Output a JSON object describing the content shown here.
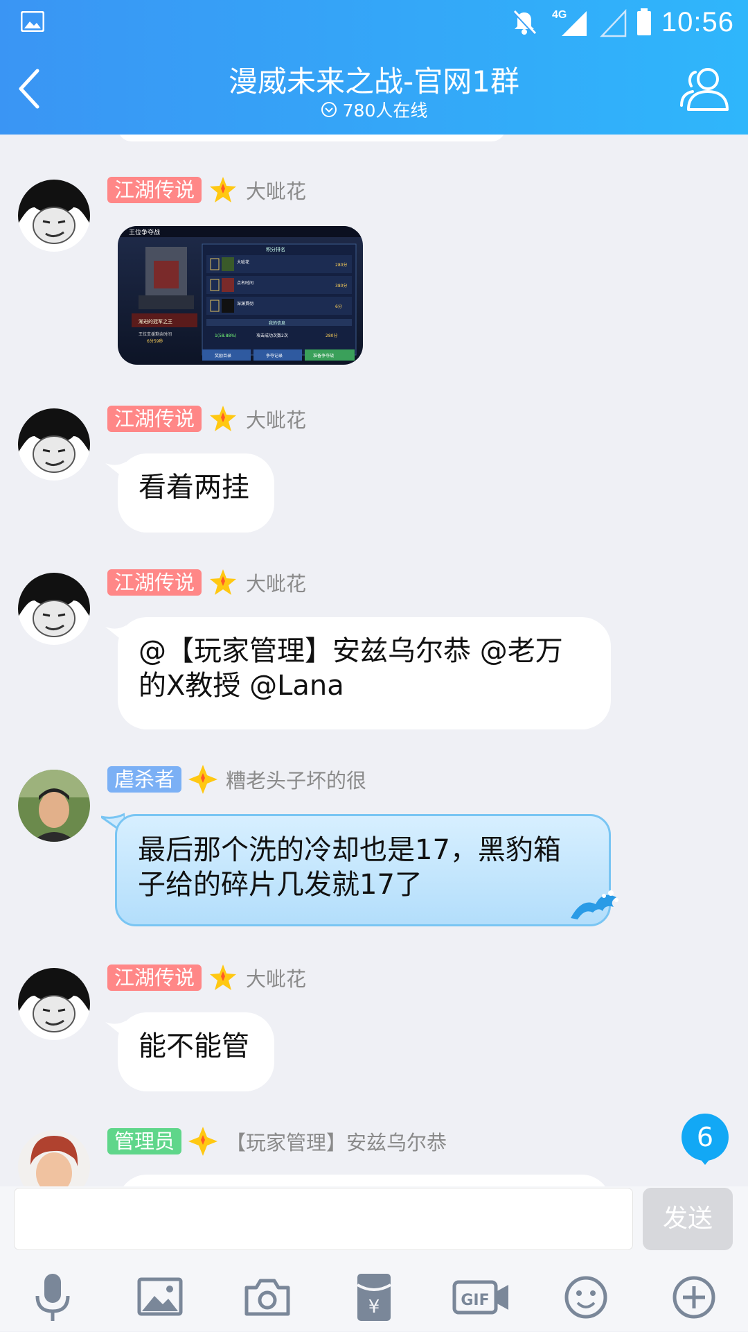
{
  "status_bar": {
    "time": "10:56",
    "network": "4G"
  },
  "header": {
    "title": "漫威未来之战-官网1群",
    "online": "780人在线"
  },
  "messages": [
    {
      "badge": "江湖传说",
      "nick": "大呲花",
      "type": "image"
    },
    {
      "badge": "江湖传说",
      "nick": "大呲花",
      "text": "看着两挂"
    },
    {
      "badge": "江湖传说",
      "nick": "大呲花",
      "line1": "@【玩家管理】安兹乌尔恭 @老万",
      "line2": "的X教授 @Lana"
    },
    {
      "badge": "虐杀者",
      "nick": "糟老头子坏的很",
      "line1": "最后那个洗的冷却也是17，黑豹箱",
      "line2": "子给的碎片几发就17了"
    },
    {
      "badge": "江湖传说",
      "nick": "大呲花",
      "text": "能不能管"
    },
    {
      "badge": "管理员",
      "nick": "【玩家管理】安兹乌尔恭"
    }
  ],
  "game_screenshot": {
    "title": "王位争夺战",
    "panel_title": "积分排名",
    "ranks": [
      {
        "name": "大呲花",
        "score": "280分"
      },
      {
        "name": "点名时间",
        "score": "380分"
      },
      {
        "name": "深渊贯彻",
        "score": "6分"
      }
    ],
    "my_info": "我的信息",
    "my_rank": "1(58.88%)",
    "my_attack": "攻击成功次数2次",
    "my_score": "280分",
    "buttons": [
      "奖励目录",
      "争夺记录",
      "准备争夺战"
    ],
    "left_caption": "王位支援剩余时间",
    "left_time": "6分59秒",
    "left_banner": "渐进的冠军之王"
  },
  "unread_count": "6",
  "input": {
    "placeholder": "",
    "send_label": "发送"
  },
  "toolbar": [
    "microphone-icon",
    "image-icon",
    "camera-icon",
    "red-packet-icon",
    "gif-icon",
    "emoji-icon",
    "plus-icon"
  ]
}
